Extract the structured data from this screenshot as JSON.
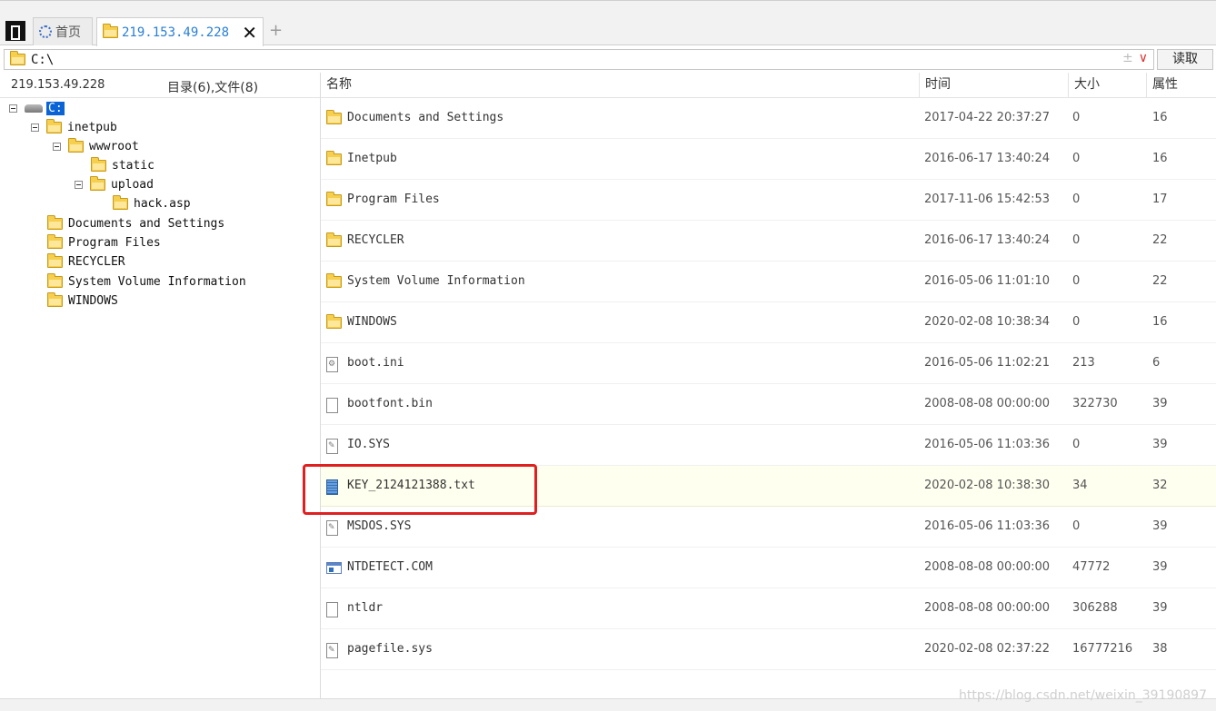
{
  "tabs": {
    "home_label": "首页",
    "active_label": "219.153.49.228",
    "close_glyph": "✕",
    "add_glyph": "+"
  },
  "address": {
    "path": "C:\\",
    "read_label": "读取",
    "dropdown_glyph": "∨",
    "plus_minus_glyph": "±"
  },
  "left_panel": {
    "host": "219.153.49.228",
    "summary": "目录(6),文件(8)",
    "tree": [
      {
        "label": "C:",
        "type": "drive",
        "toggle": true,
        "selected": true
      },
      {
        "label": "inetpub",
        "type": "folder",
        "toggle": true
      },
      {
        "label": "wwwroot",
        "type": "folder",
        "toggle": true
      },
      {
        "label": "static",
        "type": "folder",
        "toggle": false
      },
      {
        "label": "upload",
        "type": "folder",
        "toggle": true
      },
      {
        "label": "hack.asp",
        "type": "folder",
        "toggle": false
      },
      {
        "label": "Documents and Settings",
        "type": "folder",
        "toggle": false
      },
      {
        "label": "Program Files",
        "type": "folder",
        "toggle": false
      },
      {
        "label": "RECYCLER",
        "type": "folder",
        "toggle": false
      },
      {
        "label": "System Volume Information",
        "type": "folder",
        "toggle": false
      },
      {
        "label": "WINDOWS",
        "type": "folder",
        "toggle": false
      }
    ]
  },
  "columns": {
    "name": "名称",
    "time": "时间",
    "size": "大小",
    "attr": "属性"
  },
  "files": [
    {
      "name": "Documents and Settings",
      "icon": "folder-icon",
      "time": "2017-04-22 20:37:27",
      "size": "0",
      "attr": "16"
    },
    {
      "name": "Inetpub",
      "icon": "folder-icon",
      "time": "2016-06-17 13:40:24",
      "size": "0",
      "attr": "16"
    },
    {
      "name": "Program Files",
      "icon": "folder-icon",
      "time": "2017-11-06 15:42:53",
      "size": "0",
      "attr": "17"
    },
    {
      "name": "RECYCLER",
      "icon": "folder-icon",
      "time": "2016-06-17 13:40:24",
      "size": "0",
      "attr": "22"
    },
    {
      "name": "System Volume Information",
      "icon": "folder-icon",
      "time": "2016-05-06 11:01:10",
      "size": "0",
      "attr": "22"
    },
    {
      "name": "WINDOWS",
      "icon": "folder-icon",
      "time": "2020-02-08 10:38:34",
      "size": "0",
      "attr": "16"
    },
    {
      "name": "boot.ini",
      "icon": "config-file-icon",
      "time": "2016-05-06 11:02:21",
      "size": "213",
      "attr": "6"
    },
    {
      "name": "bootfont.bin",
      "icon": "blank-file-icon",
      "time": "2008-08-08 00:00:00",
      "size": "322730",
      "attr": "39"
    },
    {
      "name": "IO.SYS",
      "icon": "system-file-icon",
      "time": "2016-05-06 11:03:36",
      "size": "0",
      "attr": "39"
    },
    {
      "name": "KEY_2124121388.txt",
      "icon": "text-file-icon",
      "time": "2020-02-08 10:38:30",
      "size": "34",
      "attr": "32",
      "highlight": true
    },
    {
      "name": "MSDOS.SYS",
      "icon": "system-file-icon",
      "time": "2016-05-06 11:03:36",
      "size": "0",
      "attr": "39"
    },
    {
      "name": "NTDETECT.COM",
      "icon": "executable-file-icon",
      "time": "2008-08-08 00:00:00",
      "size": "47772",
      "attr": "39"
    },
    {
      "name": "ntldr",
      "icon": "blank-file-icon",
      "time": "2008-08-08 00:00:00",
      "size": "306288",
      "attr": "39"
    },
    {
      "name": "pagefile.sys",
      "icon": "system-file-icon",
      "time": "2020-02-08 02:37:22",
      "size": "16777216",
      "attr": "38"
    }
  ],
  "watermark": "https://blog.csdn.net/weixin_39190897",
  "colors": {
    "selection": "#0a64d6",
    "active_tab_text": "#2a7fd4",
    "annotation_box": "#e02020",
    "folder": "#f6cf4f"
  }
}
